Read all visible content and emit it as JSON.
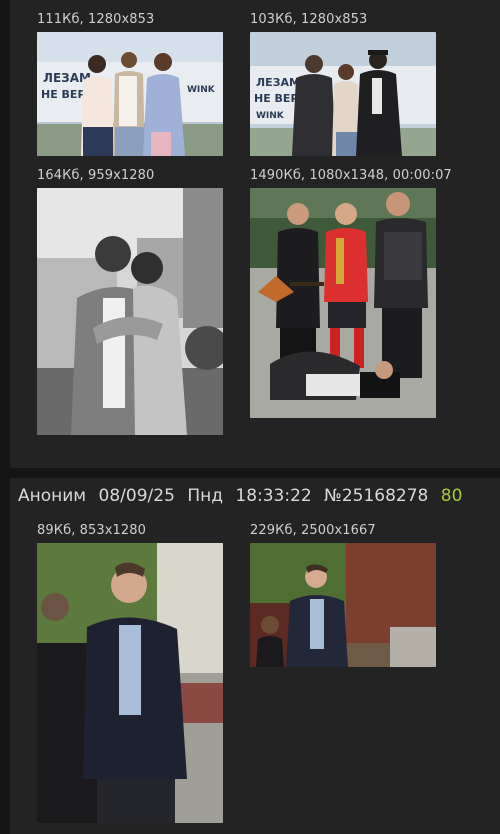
{
  "posts": [
    {
      "files": [
        {
          "info": "111Кб, 1280x853"
        },
        {
          "info": "103Кб, 1280x853"
        },
        {
          "info": "164Кб, 959x1280"
        },
        {
          "info": "1490Кб, 1080x1348, 00:00:07"
        }
      ]
    },
    {
      "header": {
        "name": "Аноним",
        "date": "08/09/25",
        "weekday": "Пнд",
        "time": "18:33:22",
        "number": "№25168278",
        "replies": "80"
      },
      "files": [
        {
          "info": "89Кб, 853x1280"
        },
        {
          "info": "229Кб, 2500x1667"
        }
      ]
    }
  ],
  "banner_text": {
    "line1": "ЛЕЗАМ",
    "line2": "НЕ ВЕРИ",
    "brand": "WINK"
  },
  "colors": {
    "background": "#151515",
    "post_background": "#232323",
    "text": "#d9d9d9",
    "file_info": "#cfcfcf",
    "reply_count": "#a8c93a"
  }
}
